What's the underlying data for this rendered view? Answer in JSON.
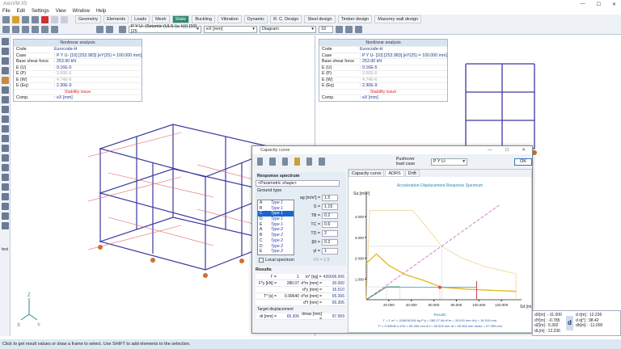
{
  "app": {
    "title": "AxisVM X5",
    "window_controls": [
      "—",
      "☐",
      "✕"
    ]
  },
  "menu": [
    "File",
    "Edit",
    "Settings",
    "View",
    "Window",
    "Help"
  ],
  "tabs": [
    "Geometry",
    "Elements",
    "Loads",
    "Mesh",
    "Static",
    "Buckling",
    "Vibration",
    "Dynamic",
    "R. C. Design",
    "Steel design",
    "Timber design",
    "Masonry wall design"
  ],
  "active_tab": "Static",
  "toolbar": {
    "load_case": "P Y U- (Seismic (ULS (a, k))) [10] [25",
    "component": "eX [mm]",
    "display": "Diagram",
    "scale": "10"
  },
  "info_panel": {
    "title": "Nonlinear analysis",
    "rows": [
      {
        "k": "Code",
        "v": "Eurocode-H"
      },
      {
        "k": "Case",
        "v": ": P Y U- [10] [253.983] [eY(25) = 100.000 mm]"
      },
      {
        "k": "Base shear force",
        "v": ": 253.90 kN"
      },
      {
        "k": "E (U)",
        "v": ": 9.16E-5"
      },
      {
        "k": "E (P)",
        "v": ": 2.00E-6",
        "grey": true
      },
      {
        "k": "E (W)",
        "v": ": 4.74E-6",
        "grey": true
      },
      {
        "k": "E (Eq)",
        "v": ": 2.30E-9"
      }
    ],
    "warning": "Stability issue",
    "comp_k": "Comp.",
    "comp_v": ": eX [mm]"
  },
  "dialog": {
    "title": "Capacity curve",
    "pushover_label": "Pushover load case",
    "pushover_value": "P Y U-",
    "ok": "OK",
    "tabs": [
      "Capacity curve",
      "ADRS",
      "Drift"
    ],
    "active_tab": "ADRS",
    "response_spectrum_label": "Response spectrum",
    "spectrum_shape": "<Parametric shape>",
    "ground_type_label": "Ground type",
    "ground_types": [
      [
        "A",
        "Type 1"
      ],
      [
        "B",
        "Type 1"
      ],
      [
        "C",
        "Type 1"
      ],
      [
        "D",
        "Type 1"
      ],
      [
        "E",
        "Type 1"
      ],
      [
        "A",
        "Type 2"
      ],
      [
        "B",
        "Type 2"
      ],
      [
        "C",
        "Type 2"
      ],
      [
        "D",
        "Type 2"
      ],
      [
        "E",
        "Type 2"
      ]
    ],
    "selected_ground": 2,
    "params": [
      {
        "n": "ag [m/s²] =",
        "v": "1.5"
      },
      {
        "n": "S =",
        "v": "1.15"
      },
      {
        "n": "TB =",
        "v": "0.2"
      },
      {
        "n": "TC =",
        "v": "0.6"
      },
      {
        "n": "TD =",
        "v": "2"
      },
      {
        "n": "β0 =",
        "v": "0.2"
      },
      {
        "n": "γI =",
        "v": "1"
      }
    ],
    "local_spectrum": "Local spectrum",
    "fo": "F0 = 2.5",
    "results_label": "Results",
    "results": [
      [
        "Γ =",
        "1",
        "m* [kg] =",
        "426606.006"
      ],
      [
        "F*y [kN] =",
        "280.07",
        "d*m [mm] =",
        "30.000"
      ],
      [
        "",
        "",
        "d*y [mm] =",
        "16.510"
      ],
      [
        "T* [s] =",
        "0.99640",
        "d*et [mm] =",
        "65.306"
      ],
      [
        "",
        "",
        "d*t [mm] =",
        "65.306"
      ]
    ],
    "target_label": "Target displacement",
    "target": [
      "dt [mm] =",
      "65.306",
      "dmax [mm] =",
      "97.959"
    ]
  },
  "chart_data": {
    "type": "line",
    "title": "Acceleration-Displacement Response Spectrum",
    "xlabel": "Sd [mm]",
    "ylabel": "Sa [m/s²]",
    "xlim": [
      0,
      135
    ],
    "ylim": [
      0,
      4.9
    ],
    "xticks": [
      "20.000",
      "40.000",
      "60.000",
      "80.000",
      "100.000",
      "120.000"
    ],
    "xtick_values": [
      20,
      40,
      60,
      80,
      100,
      120
    ],
    "yticks": [
      "1.000",
      "2.000",
      "3.000",
      "4.000"
    ],
    "ytick_values": [
      1,
      2,
      3,
      4
    ],
    "series": [
      {
        "name": "elastic spectrum",
        "color": "#f0c878",
        "dash": "2,1",
        "points": [
          [
            0,
            0
          ],
          [
            3,
            4.3
          ],
          [
            41,
            4.3
          ],
          [
            55,
            3.4
          ],
          [
            67,
            2.57
          ],
          [
            85,
            2.0
          ],
          [
            105,
            1.6
          ],
          [
            133,
            1.25
          ],
          [
            133,
            0
          ]
        ]
      },
      {
        "name": "inelastic spectrum",
        "color": "#e8b820",
        "points": [
          [
            0,
            1.75
          ],
          [
            9,
            2.2
          ],
          [
            20,
            1.65
          ],
          [
            35,
            1.2
          ],
          [
            50,
            0.95
          ],
          [
            67,
            0.6
          ],
          [
            90,
            0.5
          ],
          [
            133,
            0.4
          ]
        ]
      },
      {
        "name": "period line",
        "color": "#d080d0",
        "dash": "4,2",
        "points": [
          [
            0,
            0
          ],
          [
            118,
            4.55
          ]
        ]
      },
      {
        "name": "capacity curve",
        "color": "#2a8a3a",
        "points": [
          [
            0,
            0
          ],
          [
            18,
            0.62
          ],
          [
            30,
            0.62
          ]
        ]
      },
      {
        "name": "bilinear",
        "color": "#5aaad8",
        "points": [
          [
            18,
            0.6
          ],
          [
            98,
            0.6
          ]
        ]
      },
      {
        "name": "dmax",
        "color": "#d04050",
        "points": [
          [
            98,
            0
          ],
          [
            98,
            0.9
          ]
        ]
      }
    ],
    "performance_point": [
      65.3,
      0.6
    ],
    "results_label": "Results",
    "results_line1": "Γ = 1    m* = 426606.006 kg    F*y = 280.07 kN    d*m = 30.000 mm    d*y = 16.510 mm",
    "results_line2": "T* = 0.99640 s    d*et = 65.306 mm    d*t = 65.306 mm    dt = 65.306 mm    dmax = 97.959 mm"
  },
  "coords": {
    "left": [
      "dX[m] : -11.000",
      "dY[m] : -0.785",
      "dZ[m] : 5.302",
      "dL[m] : 12.236"
    ],
    "right": [
      "d r[m] : 12.236",
      "d α[°] : 98.42",
      "dh[m] : -11.000"
    ],
    "badge": "d"
  },
  "status": "Click to get result values or draw a frame to select. Use SHIFT to add elements to the selection.",
  "axis_labels": {
    "x": "X",
    "y": "Y",
    "z": "Z"
  },
  "left_label": "test"
}
